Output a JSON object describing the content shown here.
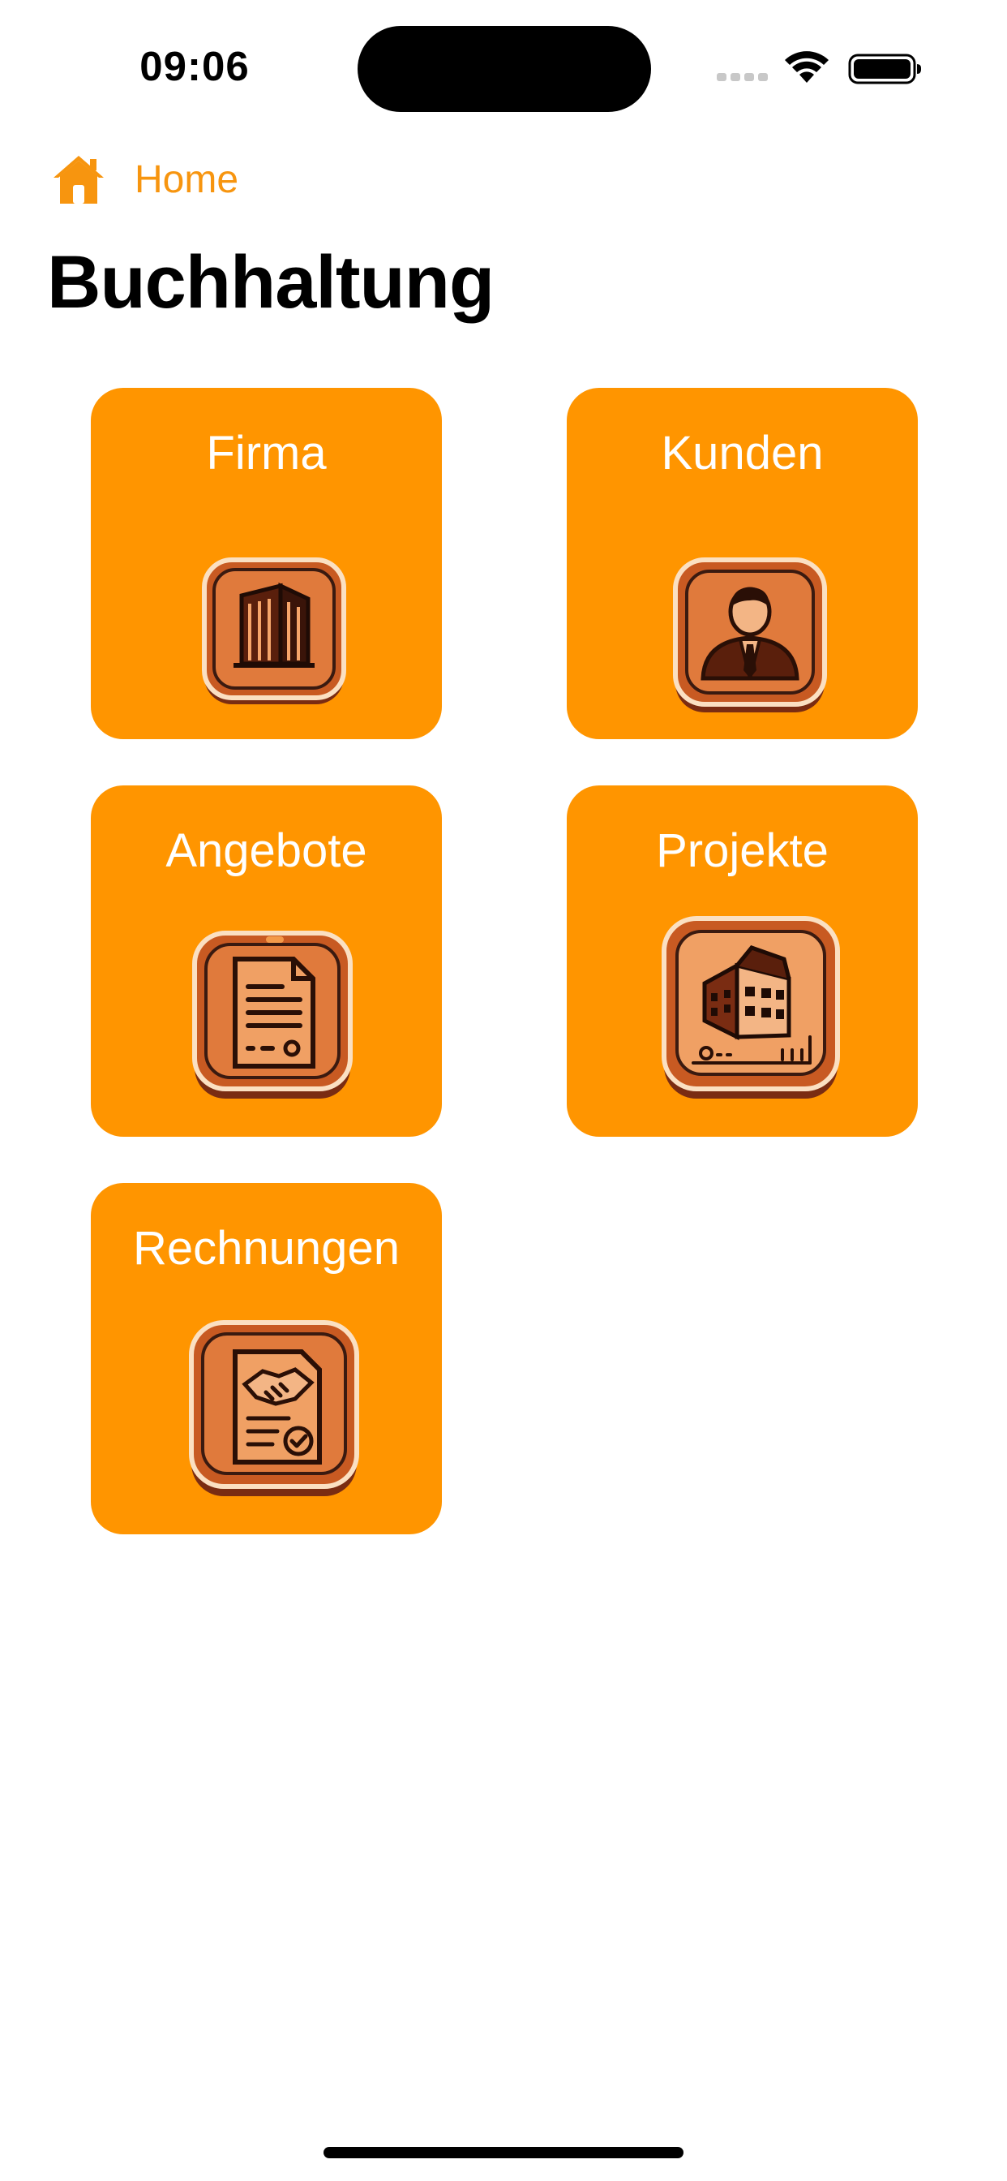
{
  "status_bar": {
    "time": "09:06",
    "icons": [
      "cellular-signal-icon",
      "wifi-icon",
      "battery-icon"
    ]
  },
  "nav": {
    "back_label": "Home",
    "back_icon": "home-icon"
  },
  "page": {
    "title": "Buchhaltung"
  },
  "tiles": [
    {
      "label": "Firma",
      "icon": "office-building-icon"
    },
    {
      "label": "Kunden",
      "icon": "customer-person-icon"
    },
    {
      "label": "Angebote",
      "icon": "quote-document-icon"
    },
    {
      "label": "Projekte",
      "icon": "project-building-icon"
    },
    {
      "label": "Rechnungen",
      "icon": "invoice-handshake-icon"
    }
  ],
  "colors": {
    "accent": "#F7950F",
    "tile_background": "#FF9500",
    "tile_text": "#FFFFFF"
  }
}
